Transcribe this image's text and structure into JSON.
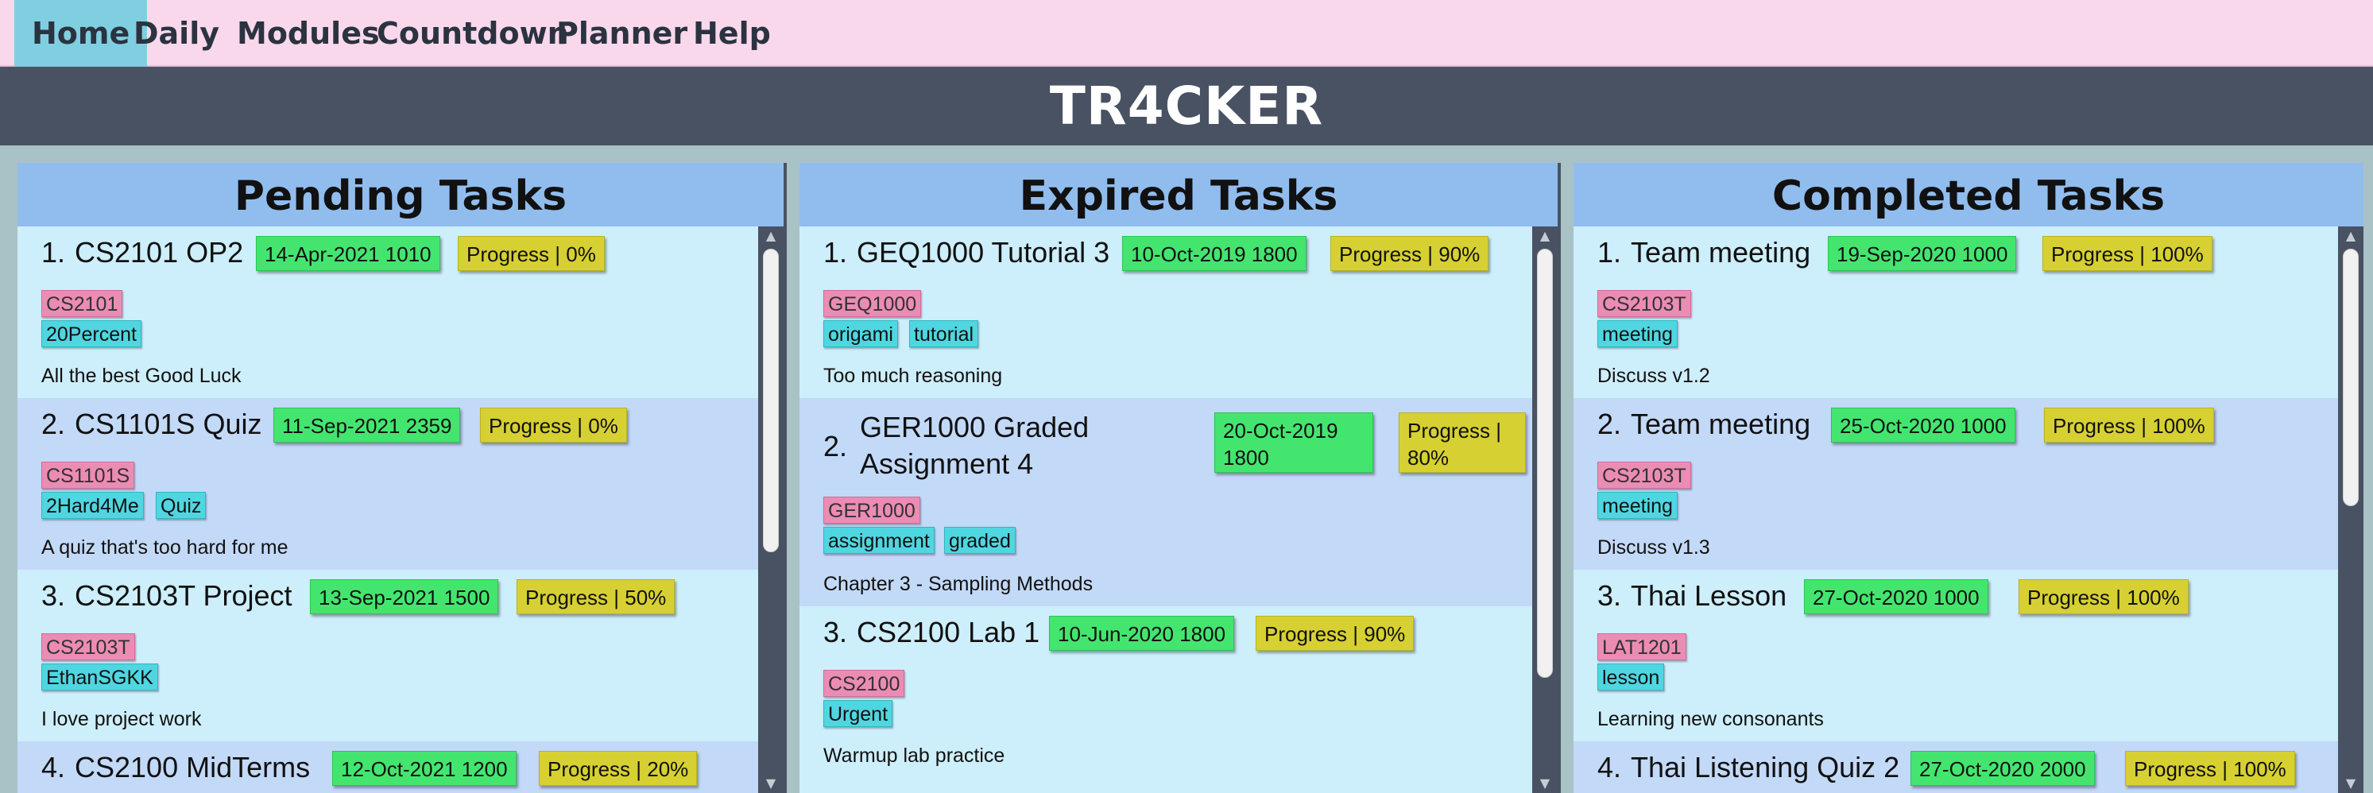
{
  "menu": {
    "items": [
      {
        "label": "Home",
        "active": true
      },
      {
        "label": "Daily"
      },
      {
        "label": "Modules"
      },
      {
        "label": "Countdown"
      },
      {
        "label": "Planner"
      },
      {
        "label": "Help"
      }
    ]
  },
  "app": {
    "title": "TR4CKER"
  },
  "colors": {
    "menubar": "#fad8ec",
    "titlebar": "#485262",
    "panel_header": "#91bdee",
    "date_badge": "#44e56f",
    "progress_badge": "#d6d032",
    "module_tag": "#eb8cb4",
    "tag": "#4fd6e0"
  },
  "panels": {
    "pending": {
      "title": "Pending Tasks",
      "tasks": [
        {
          "num": "1.",
          "name": "CS2101 OP2",
          "date": "14-Apr-2021 1010",
          "progress": "Progress | 0%",
          "progress_value": 0,
          "module": "CS2101",
          "tags": [
            "20Percent"
          ],
          "desc": "All the best Good Luck"
        },
        {
          "num": "2.",
          "name": "CS1101S Quiz",
          "date": "11-Sep-2021 2359",
          "progress": "Progress | 0%",
          "progress_value": 0,
          "module": "CS1101S",
          "tags": [
            "2Hard4Me",
            "Quiz"
          ],
          "desc": "A quiz that's too hard for me"
        },
        {
          "num": "3.",
          "name": "CS2103T Project",
          "date": "13-Sep-2021 1500",
          "progress": "Progress | 50%",
          "progress_value": 50,
          "module": "CS2103T",
          "tags": [
            "EthanSGKK"
          ],
          "desc": "I love project work"
        },
        {
          "num": "4.",
          "name": "CS2100 MidTerms",
          "date": "12-Oct-2021 1200",
          "progress": "Progress | 20%",
          "progress_value": 20
        }
      ]
    },
    "expired": {
      "title": "Expired Tasks",
      "tasks": [
        {
          "num": "1.",
          "name": "GEQ1000 Tutorial 3",
          "date": "10-Oct-2019 1800",
          "progress": "Progress | 90%",
          "progress_value": 90,
          "module": "GEQ1000",
          "tags": [
            "origami",
            "tutorial"
          ],
          "desc": "Too much reasoning"
        },
        {
          "num": "2.",
          "name": "GER1000 Graded Assignment 4",
          "date": "20-Oct-2019 1800",
          "progress": "Progress | 80%",
          "progress_value": 80,
          "module": "GER1000",
          "tags": [
            "assignment",
            "graded"
          ],
          "desc": "Chapter 3 - Sampling Methods"
        },
        {
          "num": "3.",
          "name": "CS2100 Lab 1",
          "date": "10-Jun-2020 1800",
          "progress": "Progress | 90%",
          "progress_value": 90,
          "module": "CS2100",
          "tags": [
            "Urgent"
          ],
          "desc": "Warmup lab practice"
        }
      ]
    },
    "completed": {
      "title": "Completed Tasks",
      "tasks": [
        {
          "num": "1.",
          "name": "Team meeting",
          "date": "19-Sep-2020 1000",
          "progress": "Progress | 100%",
          "progress_value": 100,
          "module": "CS2103T",
          "tags": [
            "meeting"
          ],
          "desc": "Discuss v1.2"
        },
        {
          "num": "2.",
          "name": "Team meeting",
          "date": "25-Oct-2020 1000",
          "progress": "Progress | 100%",
          "progress_value": 100,
          "module": "CS2103T",
          "tags": [
            "meeting"
          ],
          "desc": "Discuss v1.3"
        },
        {
          "num": "3.",
          "name": "Thai Lesson",
          "date": "27-Oct-2020 1000",
          "progress": "Progress | 100%",
          "progress_value": 100,
          "module": "LAT1201",
          "tags": [
            "lesson"
          ],
          "desc": "Learning new consonants"
        },
        {
          "num": "4.",
          "name": "Thai Listening Quiz 2",
          "date": "27-Oct-2020 2000",
          "progress": "Progress | 100%",
          "progress_value": 100
        }
      ]
    }
  }
}
